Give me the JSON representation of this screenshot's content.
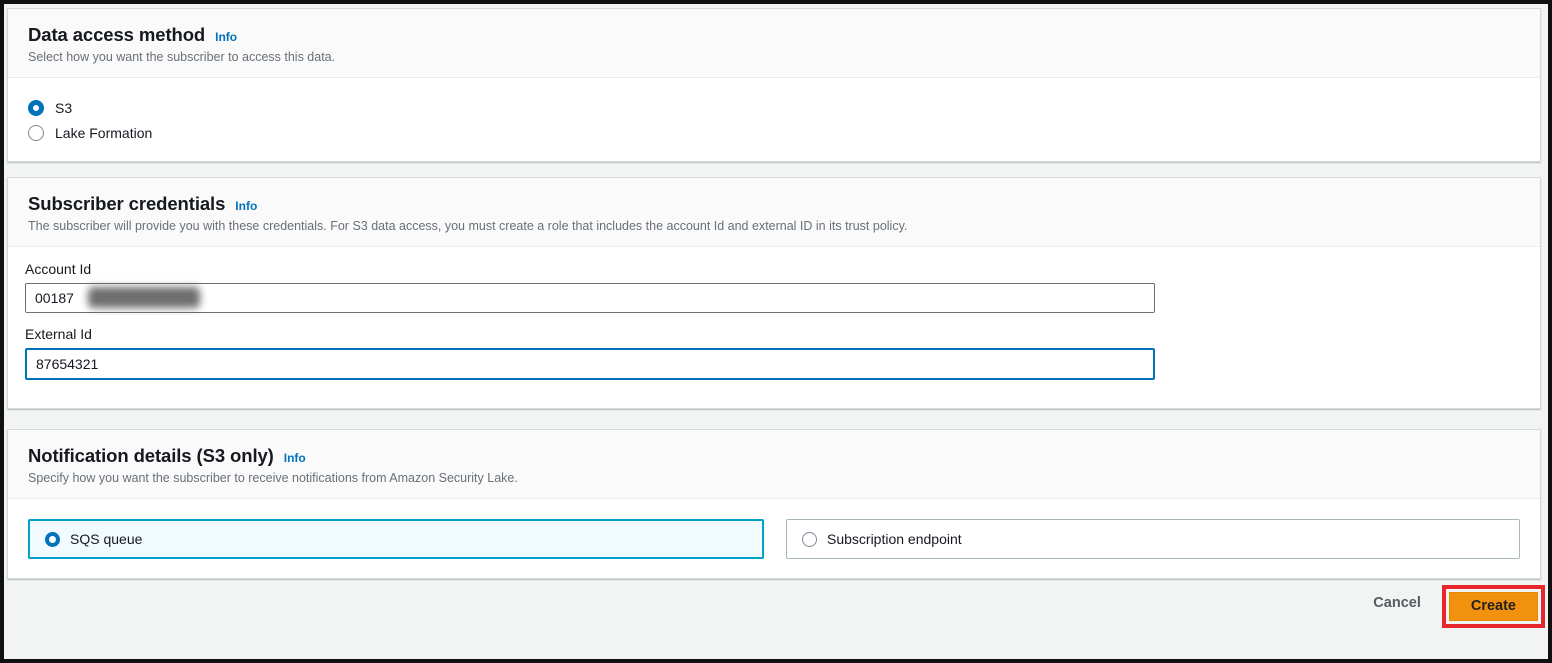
{
  "colors": {
    "accent_blue": "#0073bb",
    "tile_selected_border": "#00a1c9",
    "tile_selected_bg": "#f1faff",
    "create_button_orange": "#f2910d",
    "annotation_red": "#e8262d",
    "info_link_blue": "#0073bb"
  },
  "sections": {
    "data_access": {
      "title": "Data access method",
      "info_label": "Info",
      "description": "Select how you want the subscriber to access this data.",
      "options": [
        {
          "label": "S3",
          "selected": true
        },
        {
          "label": "Lake Formation",
          "selected": false
        }
      ]
    },
    "subscriber_credentials": {
      "title": "Subscriber credentials",
      "info_label": "Info",
      "description": "The subscriber will provide you with these credentials. For S3 data access, you must create a role that includes the account Id and external ID in its trust policy.",
      "fields": [
        {
          "label": "Account Id",
          "value": "00187",
          "redacted": true
        },
        {
          "label": "External Id",
          "value": "87654321",
          "redacted": false
        }
      ]
    },
    "notification_details": {
      "title": "Notification details (S3 only)",
      "info_label": "Info",
      "description": "Specify how you want the subscriber to receive notifications from Amazon Security Lake.",
      "options": [
        {
          "label": "SQS queue",
          "selected": true
        },
        {
          "label": "Subscription endpoint",
          "selected": false
        }
      ]
    }
  },
  "footer": {
    "cancel_label": "Cancel",
    "create_label": "Create"
  }
}
